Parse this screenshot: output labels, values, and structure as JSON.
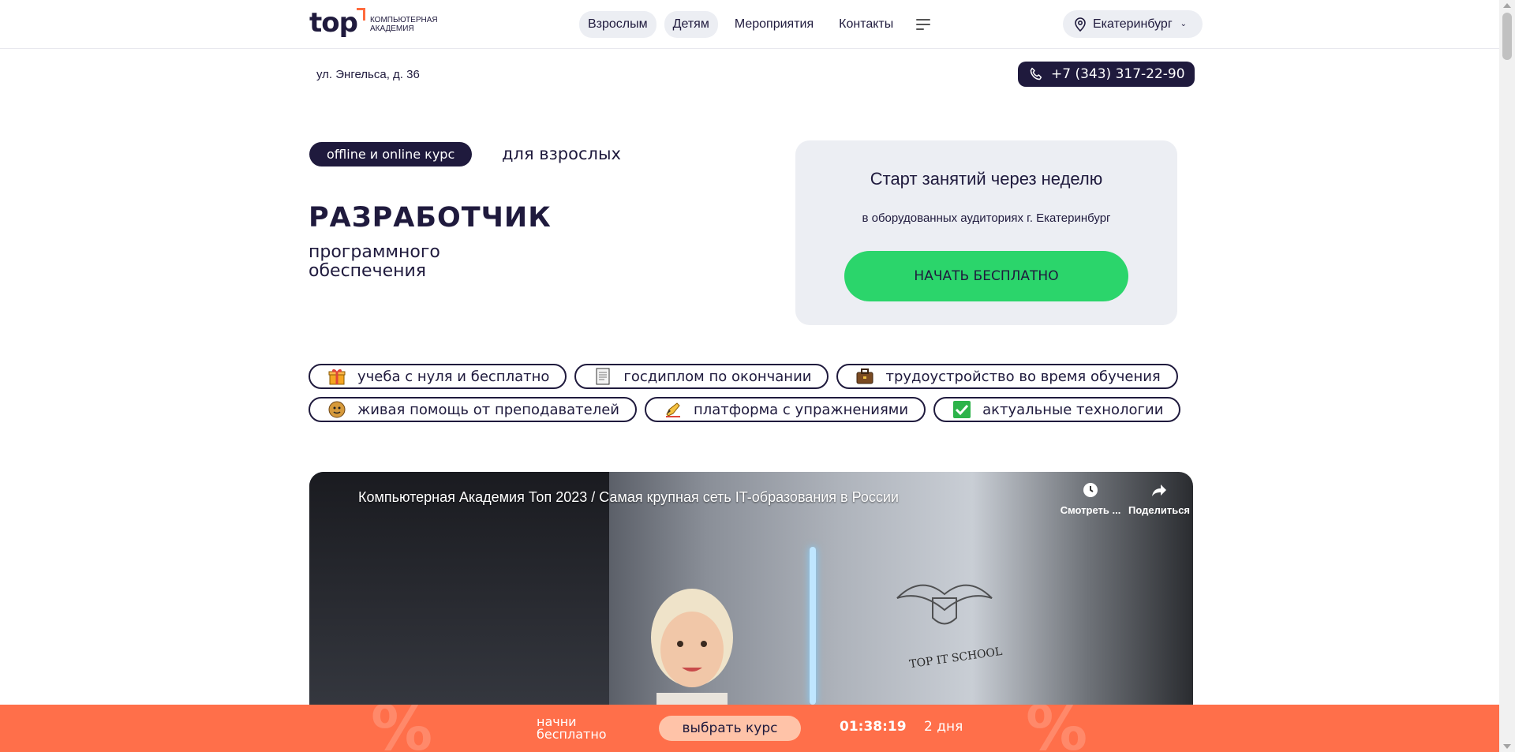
{
  "header": {
    "logo_word": "top",
    "logo_subtitle_line1": "КОМПЬЮТЕРНАЯ",
    "logo_subtitle_line2": "АКАДЕМИЯ",
    "nav": [
      "Взрослым",
      "Детям",
      "Мероприятия",
      "Контакты"
    ],
    "city": "Екатеринбург"
  },
  "subbar": {
    "address": "ул. Энгельса, д. 36",
    "phone": "+7 (343) 317-22-90"
  },
  "hero": {
    "badge": "offline и online курс",
    "audience": "для взрослых",
    "title": "РАЗРАБОТЧИК",
    "subtitle_line1": "программного",
    "subtitle_line2": "обеспечения"
  },
  "start_card": {
    "title": "Старт занятий через неделю",
    "subtitle": "в оборудованных аудиториях г. Екатеринбург",
    "cta": "НАЧАТЬ БЕСПЛАТНО"
  },
  "features": [
    {
      "label": "учеба с нуля и бесплатно",
      "icon": "gift-icon"
    },
    {
      "label": "госдиплом по окончании",
      "icon": "diploma-icon"
    },
    {
      "label": "трудоустройство во время обучения",
      "icon": "briefcase-icon"
    },
    {
      "label": "живая помощь от преподавателей",
      "icon": "teacher-icon"
    },
    {
      "label": "платформа с упражнениями",
      "icon": "pencil-icon"
    },
    {
      "label": "актуальные технологии",
      "icon": "checkmark-icon"
    }
  ],
  "video": {
    "title": "Компьютерная Академия Топ 2023 / Самая крупная сеть IT-образования в России",
    "watch_later": "Смотреть ...",
    "share": "Поделиться",
    "sign_text": "TOP IT SCHOOL"
  },
  "promo": {
    "label_line1": "начни",
    "label_line2": "бесплатно",
    "button": "выбрать курс",
    "timer": "01:38:19",
    "days": "2 дня"
  },
  "colors": {
    "brand_dark": "#1f1a3d",
    "accent_orange": "#ff6f4a",
    "cta_green": "#2bd56b",
    "card_gray": "#eceef3"
  }
}
